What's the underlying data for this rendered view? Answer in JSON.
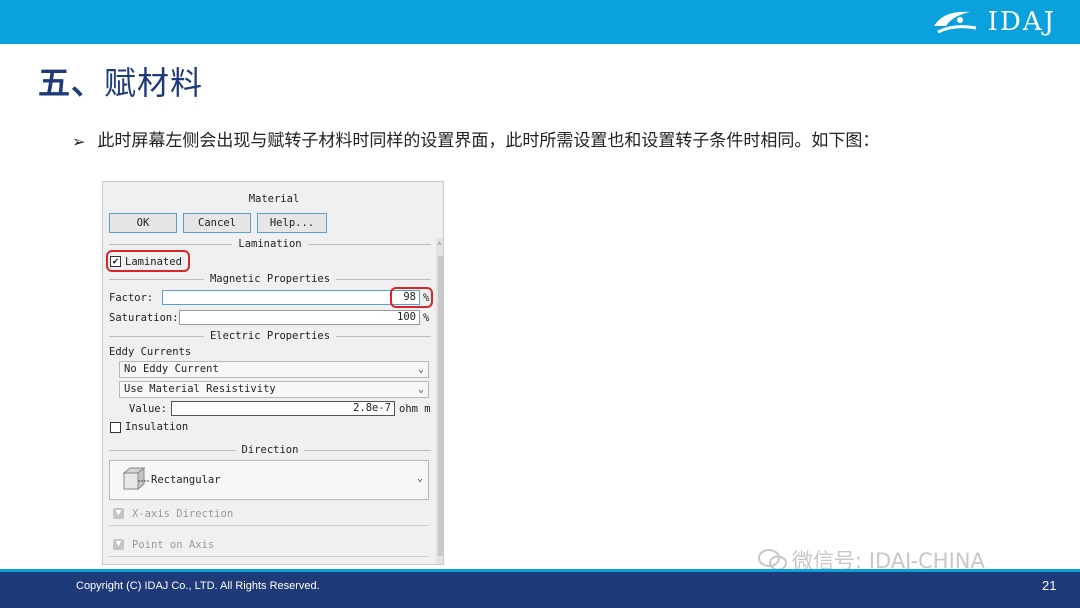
{
  "slide": {
    "logo_text": "IDAJ",
    "title_number": "五、",
    "title_text": "赋材料",
    "bullet_arrow": "➢",
    "bullet_text": "此时屏幕左侧会出现与赋转子材料时同样的设置界面，此时所需设置也和设置转子条件时相同。如下图：",
    "watermark": "微信号: IDAJ-CHINA",
    "copyright": "Copyright (C) IDAJ Co., LTD. All Rights Reserved.",
    "page_number": "21"
  },
  "colors": {
    "top_bar": "#0aa1dd",
    "footer": "#1f3a78",
    "title": "#1f3a78",
    "highlight": "#d62828"
  },
  "dialog": {
    "title": "Material",
    "buttons": {
      "ok": "OK",
      "cancel": "Cancel",
      "help": "Help..."
    },
    "lamination": {
      "section": "Lamination",
      "laminated_label": "Laminated",
      "laminated_checked": true,
      "check_mark": "✔"
    },
    "magnetic": {
      "section": "Magnetic Properties",
      "factor_label": "Factor:",
      "factor_value": "98",
      "factor_unit": "%",
      "saturation_label": "Saturation:",
      "saturation_value": "100",
      "saturation_unit": "%"
    },
    "electric": {
      "section": "Electric Properties",
      "eddy_label": "Eddy Currents",
      "eddy_select": "No Eddy Current",
      "resistivity_select": "Use Material Resistivity",
      "value_label": "Value:",
      "value": "2.8e-7",
      "value_unit": "ohm m",
      "insulation_label": "Insulation",
      "insulation_checked": false
    },
    "direction": {
      "section": "Direction",
      "select": "Rectangular",
      "x_axis": "X-axis Direction",
      "point_on_axis": "Point on Axis"
    }
  }
}
